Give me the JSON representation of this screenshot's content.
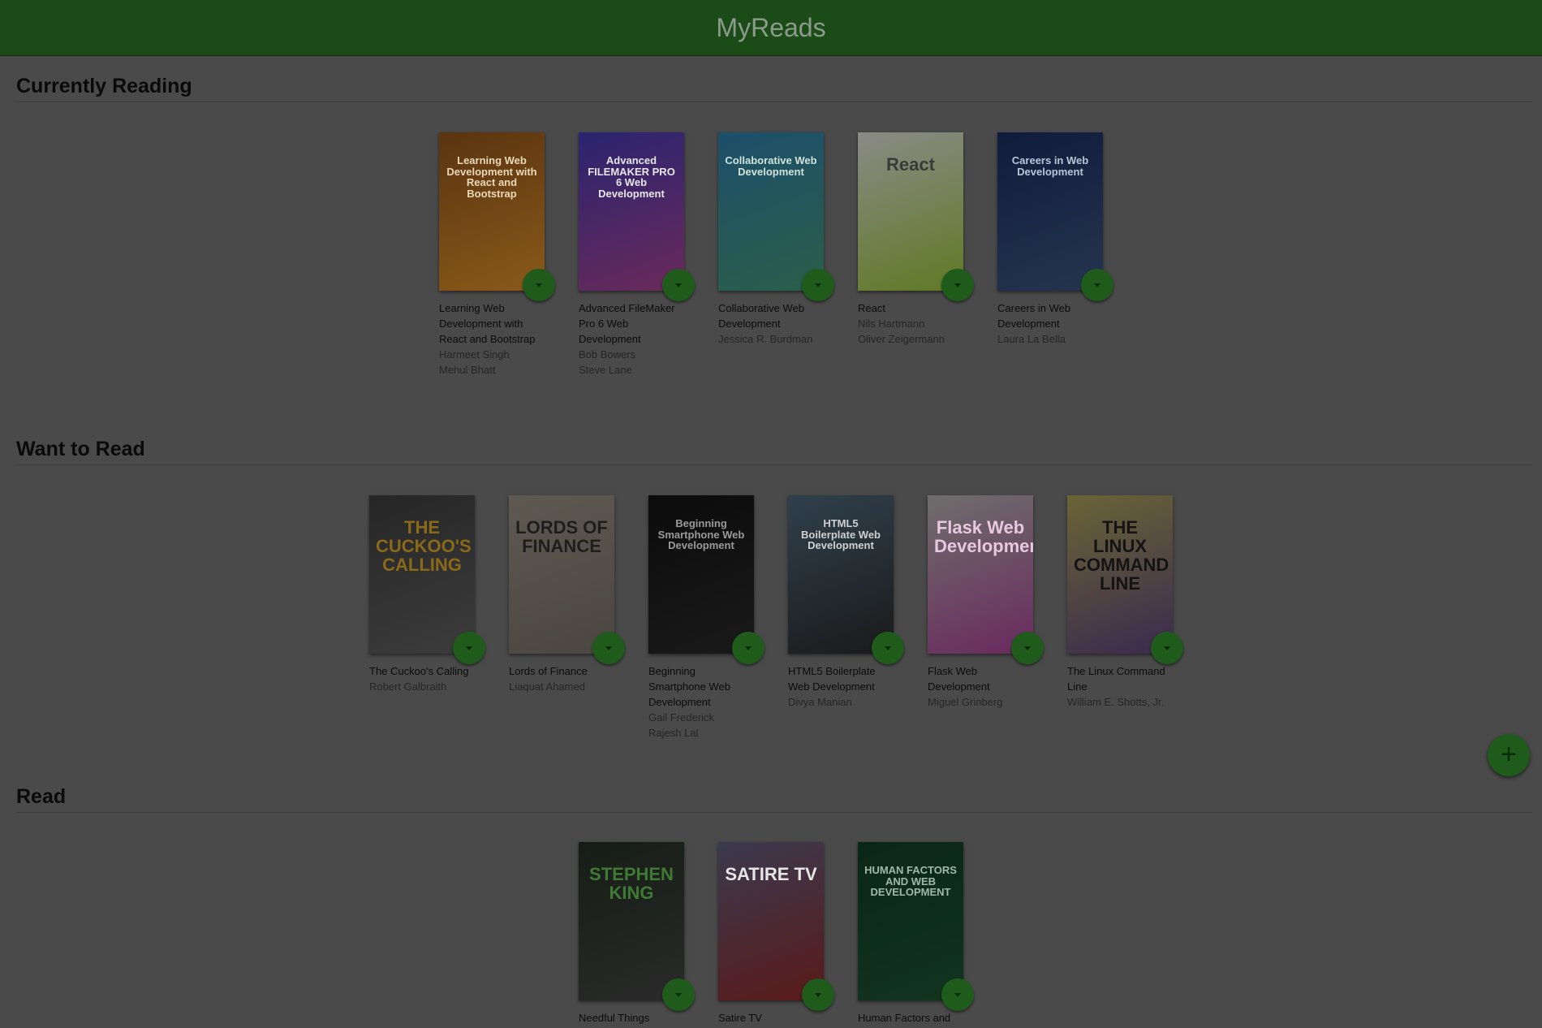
{
  "app": {
    "title": "MyReads"
  },
  "add_button": {
    "label": "+",
    "icon": "plus-icon"
  },
  "colors": {
    "header": "#1b4c18",
    "accent_button": "#1f5c1c",
    "overlay_background": "#4a4a4a"
  },
  "shelves": [
    {
      "title": "Currently Reading",
      "books": [
        {
          "title": "Learning Web Development with React and Bootstrap",
          "authors": [
            "Harmeet Singh",
            "Mehul Bhatt"
          ],
          "cover": {
            "text": "Learning Web Development with React and Bootstrap",
            "bg": "#5a3410",
            "bg2": "#8a5a1a",
            "fg": "#e9d9b8"
          }
        },
        {
          "title": "Advanced FileMaker Pro 6 Web Development",
          "authors": [
            "Bob Bowers",
            "Steve Lane"
          ],
          "cover": {
            "text": "Advanced FILEMAKER PRO 6 Web Development",
            "bg": "#2a2470",
            "bg2": "#6a2a5a",
            "fg": "#e6e6e6"
          }
        },
        {
          "title": "Collaborative Web Development",
          "authors": [
            "Jessica R. Burdman"
          ],
          "cover": {
            "text": "Collaborative Web Development",
            "bg": "#1c4f6a",
            "bg2": "#2b5f4a",
            "fg": "#cfe3d9"
          }
        },
        {
          "title": "React",
          "authors": [
            "Nils Hartmann",
            "Oliver Zeigermann"
          ],
          "cover": {
            "text": "React",
            "bg": "#8a8a86",
            "bg2": "#5f7a24",
            "fg": "#3a3a3a"
          }
        },
        {
          "title": "Careers in Web Development",
          "authors": [
            "Laura La Bella"
          ],
          "cover": {
            "text": "Careers in Web Development",
            "bg": "#0f1c3c",
            "bg2": "#25354e",
            "fg": "#b9c6d8"
          }
        }
      ]
    },
    {
      "title": "Want to Read",
      "books": [
        {
          "title": "The Cuckoo's Calling",
          "authors": [
            "Robert Galbraith"
          ],
          "cover": {
            "text": "THE CUCKOO'S CALLING",
            "bg": "#262626",
            "bg2": "#3c3c3c",
            "fg": "#8a6a1a"
          }
        },
        {
          "title": "Lords of Finance",
          "authors": [
            "Liaquat Ahamed"
          ],
          "cover": {
            "text": "LORDS OF FINANCE",
            "bg": "#5e5a52",
            "bg2": "#4a4640",
            "fg": "#1e1e1e"
          }
        },
        {
          "title": "Beginning Smartphone Web Development",
          "authors": [
            "Gail Frederick",
            "Rajesh Lal"
          ],
          "cover": {
            "text": "Beginning Smartphone Web Development",
            "bg": "#0b0b0b",
            "bg2": "#1a1a1a",
            "fg": "#9a9a9a"
          }
        },
        {
          "title": "HTML5 Boilerplate Web Development",
          "authors": [
            "Divya Manian"
          ],
          "cover": {
            "text": "HTML5 Boilerplate Web Development",
            "bg": "#30404c",
            "bg2": "#1a1a1a",
            "fg": "#d0d0d0"
          }
        },
        {
          "title": "Flask Web Development",
          "authors": [
            "Miguel Grinberg"
          ],
          "cover": {
            "text": "Flask Web Development",
            "bg": "#6e6e6c",
            "bg2": "#6a2a5e",
            "fg": "#e8c8e0"
          }
        },
        {
          "title": "The Linux Command Line",
          "authors": [
            "William E. Shotts, Jr."
          ],
          "cover": {
            "text": "THE LINUX COMMAND LINE",
            "bg": "#6a6436",
            "bg2": "#3a2a4e",
            "fg": "#141414"
          }
        }
      ]
    },
    {
      "title": "Read",
      "books": [
        {
          "title": "Needful Things",
          "authors": [],
          "cover": {
            "text": "STEPHEN KING",
            "bg": "#161d16",
            "bg2": "#2a2a2a",
            "fg": "#3e7a34"
          }
        },
        {
          "title": "Satire TV",
          "authors": [],
          "cover": {
            "text": "SATIRE TV",
            "bg": "#3a3a4e",
            "bg2": "#5a1a1a",
            "fg": "#e6e6e6"
          }
        },
        {
          "title": "Human Factors and",
          "authors": [],
          "cover": {
            "text": "HUMAN FACTORS AND WEB DEVELOPMENT",
            "bg": "#0a2618",
            "bg2": "#12341f",
            "fg": "#9fb8a8"
          }
        }
      ]
    }
  ]
}
